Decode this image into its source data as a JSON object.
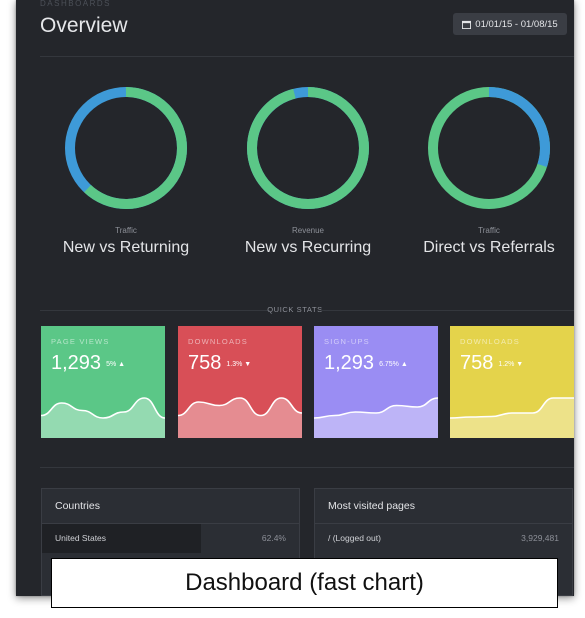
{
  "header": {
    "breadcrumb": "DASHBOARDS",
    "title": "Overview",
    "date_range": "01/01/15 - 01/08/15",
    "date_icon": "calendar-icon"
  },
  "colors": {
    "background": "#24262b",
    "green": "#5bc787",
    "blue": "#3e9ad8",
    "red": "#d84f57",
    "purple": "#9a8df3",
    "yellow": "#e4d34b"
  },
  "donuts": [
    {
      "sub": "Traffic",
      "label": "New vs Returning",
      "fraction": 0.62
    },
    {
      "sub": "Revenue",
      "label": "New vs Recurring",
      "fraction": 0.96
    },
    {
      "sub": "Traffic",
      "label": "Direct vs Referrals",
      "fraction": 0.3
    }
  ],
  "quick_stats": {
    "title": "QUICK STATS",
    "cards": [
      {
        "label": "PAGE VIEWS",
        "value": "1,293",
        "change": "5%",
        "direction": "up",
        "color": "#5bc787",
        "trend": [
          0.55,
          0.3,
          0.45,
          0.6,
          0.48,
          0.2,
          0.6
        ]
      },
      {
        "label": "DOWNLOADS",
        "value": "758",
        "change": "1.3%",
        "direction": "down",
        "color": "#d84f57",
        "trend": [
          0.55,
          0.28,
          0.35,
          0.2,
          0.55,
          0.2,
          0.5
        ]
      },
      {
        "label": "SIGN-UPS",
        "value": "1,293",
        "change": "6.75%",
        "direction": "up",
        "color": "#9a8df3",
        "trend": [
          0.6,
          0.55,
          0.48,
          0.5,
          0.35,
          0.38,
          0.2
        ]
      },
      {
        "label": "DOWNLOADS",
        "value": "758",
        "change": "1.2%",
        "direction": "down",
        "color": "#e4d34b",
        "trend": [
          0.6,
          0.58,
          0.57,
          0.5,
          0.5,
          0.2,
          0.2
        ]
      }
    ]
  },
  "panels": {
    "countries": {
      "title": "Countries",
      "rows": [
        {
          "label": "United States",
          "value": "62.4%",
          "fraction": 0.62
        }
      ]
    },
    "pages": {
      "title": "Most visited pages",
      "rows": [
        {
          "label": "/ (Logged out)",
          "value": "3,929,481"
        }
      ]
    }
  },
  "caption": "Dashboard (fast chart)"
}
